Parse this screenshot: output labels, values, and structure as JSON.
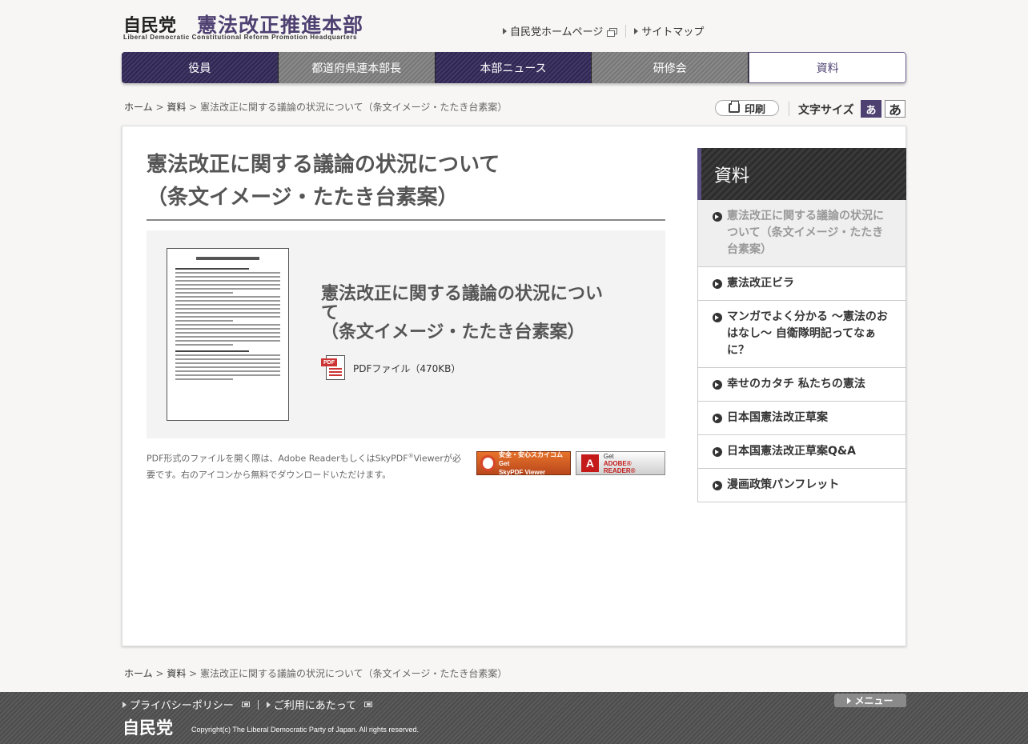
{
  "header": {
    "party_logo": "自民党",
    "hq_name": "憲法改正推進本部",
    "hq_name_en": "Liberal Democratic Constitutional Reform Promotion Headquarters",
    "links": [
      "自民党ホームページ",
      "サイトマップ"
    ]
  },
  "nav": {
    "items": [
      "役員",
      "都道府県連本部長",
      "本部ニュース",
      "研修会",
      "資料"
    ]
  },
  "breadcrumb": {
    "home": "ホーム",
    "sep1": " > ",
    "section": "資料",
    "sep2": " > ",
    "current": "憲法改正に関する議論の状況について（条文イメージ・たたき台素案）"
  },
  "tools": {
    "print_label": "印刷",
    "font_size_label": "文字サイズ",
    "font_small": "あ",
    "font_large": "あ"
  },
  "article": {
    "title_line1": "憲法改正に関する議論の状況について",
    "title_line2": "（条文イメージ・たたき台素案）",
    "doc_title_line1": "憲法改正に関する議論の状況につい",
    "doc_title_line2": "て",
    "doc_title_line3": "（条文イメージ・たたき台素案）",
    "pdf_label": "PDFファイル（470KB）",
    "pdf_tag": "PDF",
    "note_part1": "PDF形式のファイルを開く際は、Adobe ReaderもしくはSkyPDF",
    "note_reg": "®",
    "note_part2": "Viewerが必要です。右のアイコンから無料でダウンロードいただけます。",
    "badge_sky_line1": "安全・安心スカイコム Get",
    "badge_sky_line2": "SkyPDF Viewer",
    "badge_adobe_logo": "A",
    "badge_adobe_line1": "Get",
    "badge_adobe_line2": "ADOBE® READER®"
  },
  "sidebar": {
    "heading": "資料",
    "items": [
      "憲法改正に関する議論の状況について（条文イメージ・たたき台素案）",
      "憲法改正ビラ",
      "マンガでよく分かる ～憲法のおはなし～ 自衛隊明記ってなぁに？",
      "幸せのカタチ 私たちの憲法",
      "日本国憲法改正草案",
      "日本国憲法改正草案Q&A",
      "漫画政策パンフレット"
    ]
  },
  "footer": {
    "links": [
      "プライバシーポリシー",
      "ご利用にあたって"
    ],
    "menu_label": "メニュー",
    "logo": "自民党",
    "copyright": "Copyright(c) The Liberal Democratic Party of Japan. All rights reserved."
  },
  "colors": {
    "brand_purple": "#4e4172",
    "nav_gray": "#808080",
    "sidebar_dark": "#333333"
  }
}
